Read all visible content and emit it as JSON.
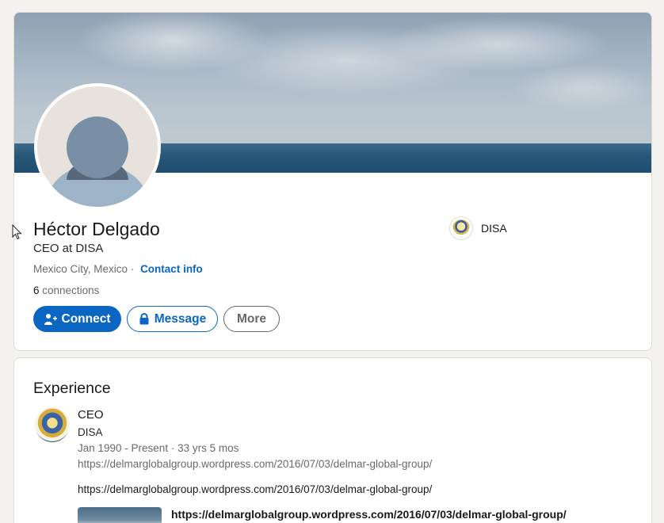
{
  "profile": {
    "name": "Héctor Delgado",
    "headline": "CEO at DISA",
    "location": "Mexico City, Mexico",
    "separator": "·",
    "contact_info": "Contact info",
    "connections_count": "6",
    "connections_label": "connections",
    "current_company": "DISA"
  },
  "actions": {
    "connect": "Connect",
    "message": "Message",
    "more": "More"
  },
  "experience": {
    "title": "Experience",
    "items": [
      {
        "role": "CEO",
        "company": "DISA",
        "dates": "Jan 1990 - Present · 33 yrs 5 mos",
        "url": "https://delmarglobalgroup.wordpress.com/2016/07/03/delmar-global-group/",
        "description": "https://delmarglobalgroup.wordpress.com/2016/07/03/delmar-global-group/",
        "media_link": "https://delmarglobalgroup.wordpress.com/2016/07/03/delmar-global-group/"
      }
    ]
  },
  "icons": {
    "connect": "person-add-icon",
    "message": "lock-icon",
    "cursor": "mouse-pointer-icon"
  },
  "colors": {
    "accent": "#0a66c2",
    "background": "#f3f2ef"
  }
}
